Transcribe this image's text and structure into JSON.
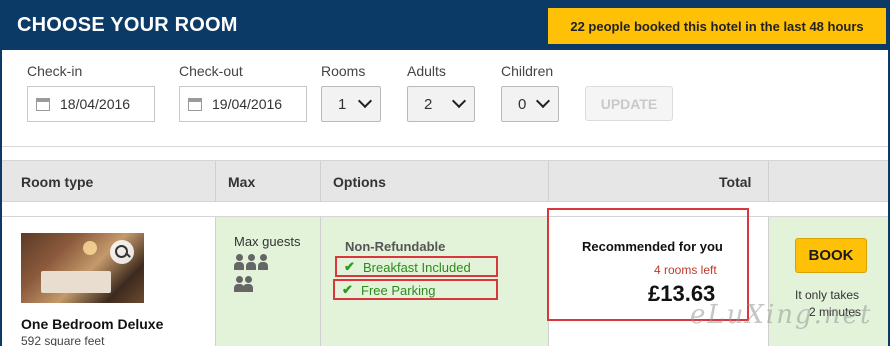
{
  "header": {
    "title": "CHOOSE YOUR ROOM",
    "promo": "22 people booked this hotel in the last 48 hours"
  },
  "search": {
    "checkin_label": "Check-in",
    "checkin_value": "18/04/2016",
    "checkout_label": "Check-out",
    "checkout_value": "19/04/2016",
    "rooms_label": "Rooms",
    "rooms_value": "1",
    "adults_label": "Adults",
    "adults_value": "2",
    "children_label": "Children",
    "children_value": "0",
    "update_label": "UPDATE"
  },
  "table": {
    "headers": [
      "Room type",
      "Max",
      "Options",
      "Total"
    ],
    "rows": [
      {
        "room_name": "One Bedroom Deluxe",
        "room_size": "592 square feet",
        "max_label": "Max guests",
        "rate_type": "Non-Refundable",
        "options": [
          "Breakfast Included",
          "Free Parking"
        ],
        "recommended": "Recommended for you",
        "rooms_left": "4 rooms left",
        "price": "£13.63",
        "book_label": "BOOK",
        "book_note_1": "It only takes",
        "book_note_2": "2 minutes"
      }
    ]
  },
  "watermark": "eLuXing.net",
  "colors": {
    "header_bg": "#0b3a66",
    "promo_bg": "#ffc107",
    "row_bg": "#e2f3da",
    "highlight_border": "#d9363e",
    "option_green": "#2e8a1e",
    "rooms_left_red": "#c0392b"
  }
}
